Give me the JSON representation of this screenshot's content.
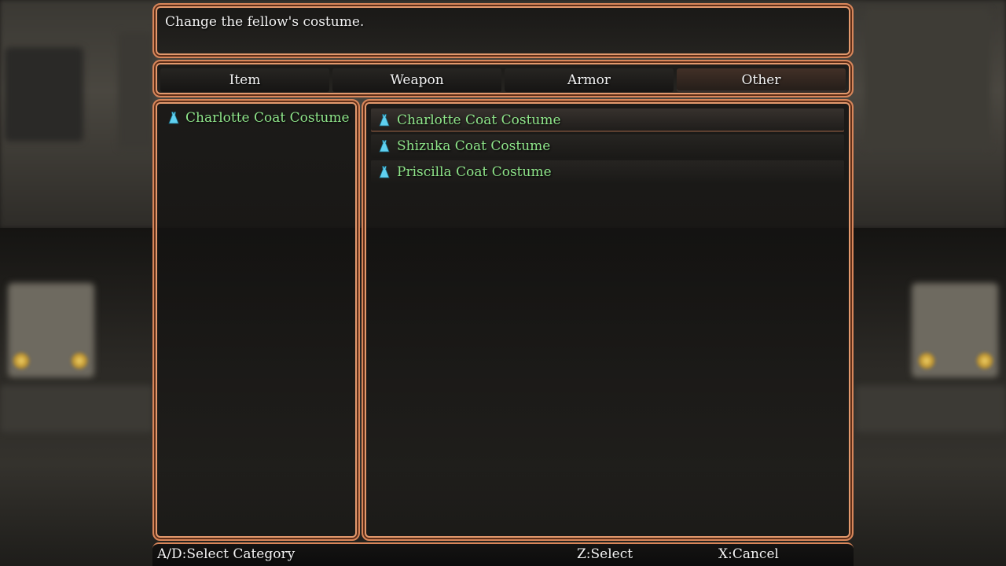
{
  "help": {
    "text": "Change the fellow's costume."
  },
  "tabs": [
    {
      "label": "Item",
      "selected": false
    },
    {
      "label": "Weapon",
      "selected": false
    },
    {
      "label": "Armor",
      "selected": false
    },
    {
      "label": "Other",
      "selected": true
    }
  ],
  "equipped": {
    "item_label": "Charlotte Coat Costume",
    "icon": "dress-icon"
  },
  "costume_list": [
    {
      "label": "Charlotte Coat Costume",
      "icon": "dress-icon",
      "cursor": true
    },
    {
      "label": "Shizuka Coat Costume",
      "icon": "dress-icon",
      "cursor": false
    },
    {
      "label": "Priscilla Coat Costume",
      "icon": "dress-icon",
      "cursor": false
    }
  ],
  "footer": {
    "select_category": "A/D:Select Category",
    "select": "Z:Select",
    "cancel": "X:Cancel"
  },
  "colors": {
    "frame": "#d8865a",
    "item_text": "#8fe58a",
    "icon": "#5fd0f0"
  }
}
